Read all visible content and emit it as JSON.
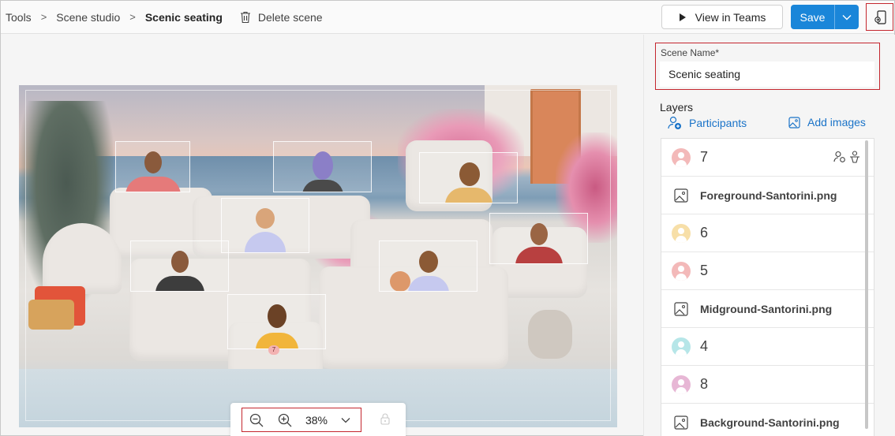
{
  "breadcrumb": {
    "items": [
      "Tools",
      "Scene studio",
      "Scenic seating"
    ],
    "separator": ">"
  },
  "toolbar": {
    "delete_label": "Delete scene",
    "view_in_teams_label": "View in Teams",
    "save_label": "Save"
  },
  "zoom": {
    "value": "38%"
  },
  "panel": {
    "scene_name_label": "Scene Name*",
    "scene_name_value": "Scenic seating",
    "layers_title": "Layers",
    "participants_label": "Participants",
    "add_images_label": "Add images"
  },
  "layers": [
    {
      "type": "participant",
      "label": "7",
      "color": "#f3b9b9"
    },
    {
      "type": "image",
      "label": "Foreground-Santorini.png"
    },
    {
      "type": "participant",
      "label": "6",
      "color": "#f7dfa8"
    },
    {
      "type": "participant",
      "label": "5",
      "color": "#f3b9b9"
    },
    {
      "type": "image",
      "label": "Midground-Santorini.png"
    },
    {
      "type": "participant",
      "label": "4",
      "color": "#b6e6e8"
    },
    {
      "type": "participant",
      "label": "8",
      "color": "#e7b7d5"
    },
    {
      "type": "image",
      "label": "Background-Santorini.png"
    }
  ],
  "canvas": {
    "seat_badge": "7"
  },
  "colors": {
    "accent": "#1a86d9",
    "link": "#1a73c8",
    "highlight": "#c4262e"
  }
}
